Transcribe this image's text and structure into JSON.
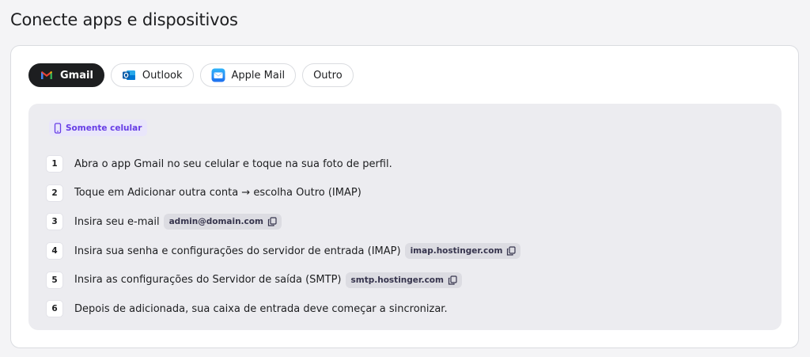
{
  "page": {
    "title": "Conecte apps e dispositivos"
  },
  "tabs": [
    {
      "label": "Gmail",
      "icon": "gmail-icon",
      "active": true
    },
    {
      "label": "Outlook",
      "icon": "outlook-icon",
      "active": false
    },
    {
      "label": "Apple Mail",
      "icon": "apple-mail-icon",
      "active": false
    },
    {
      "label": "Outro",
      "icon": "",
      "active": false
    }
  ],
  "badge": {
    "label": "Somente celular",
    "icon": "phone-icon"
  },
  "steps": [
    {
      "number": "1",
      "text": "Abra o app Gmail no seu celular e toque na sua foto de perfil."
    },
    {
      "number": "2",
      "text": "Toque em Adicionar outra conta → escolha Outro (IMAP)"
    },
    {
      "number": "3",
      "text": "Insira seu e-mail",
      "chip": "admin@domain.com"
    },
    {
      "number": "4",
      "text": "Insira sua senha e configurações do servidor de entrada (IMAP)",
      "chip": "imap.hostinger.com"
    },
    {
      "number": "5",
      "text": "Insira as configurações do Servidor de saída (SMTP)",
      "chip": "smtp.hostinger.com"
    },
    {
      "number": "6",
      "text": "Depois de adicionada, sua caixa de entrada deve começar a sincronizar."
    }
  ],
  "colors": {
    "accent": "#673de6",
    "badge_bg": "#e9e6fb",
    "active_tab": "#1d1e20",
    "panel_bg": "#ececf0",
    "chip_bg": "#dcdce2"
  }
}
